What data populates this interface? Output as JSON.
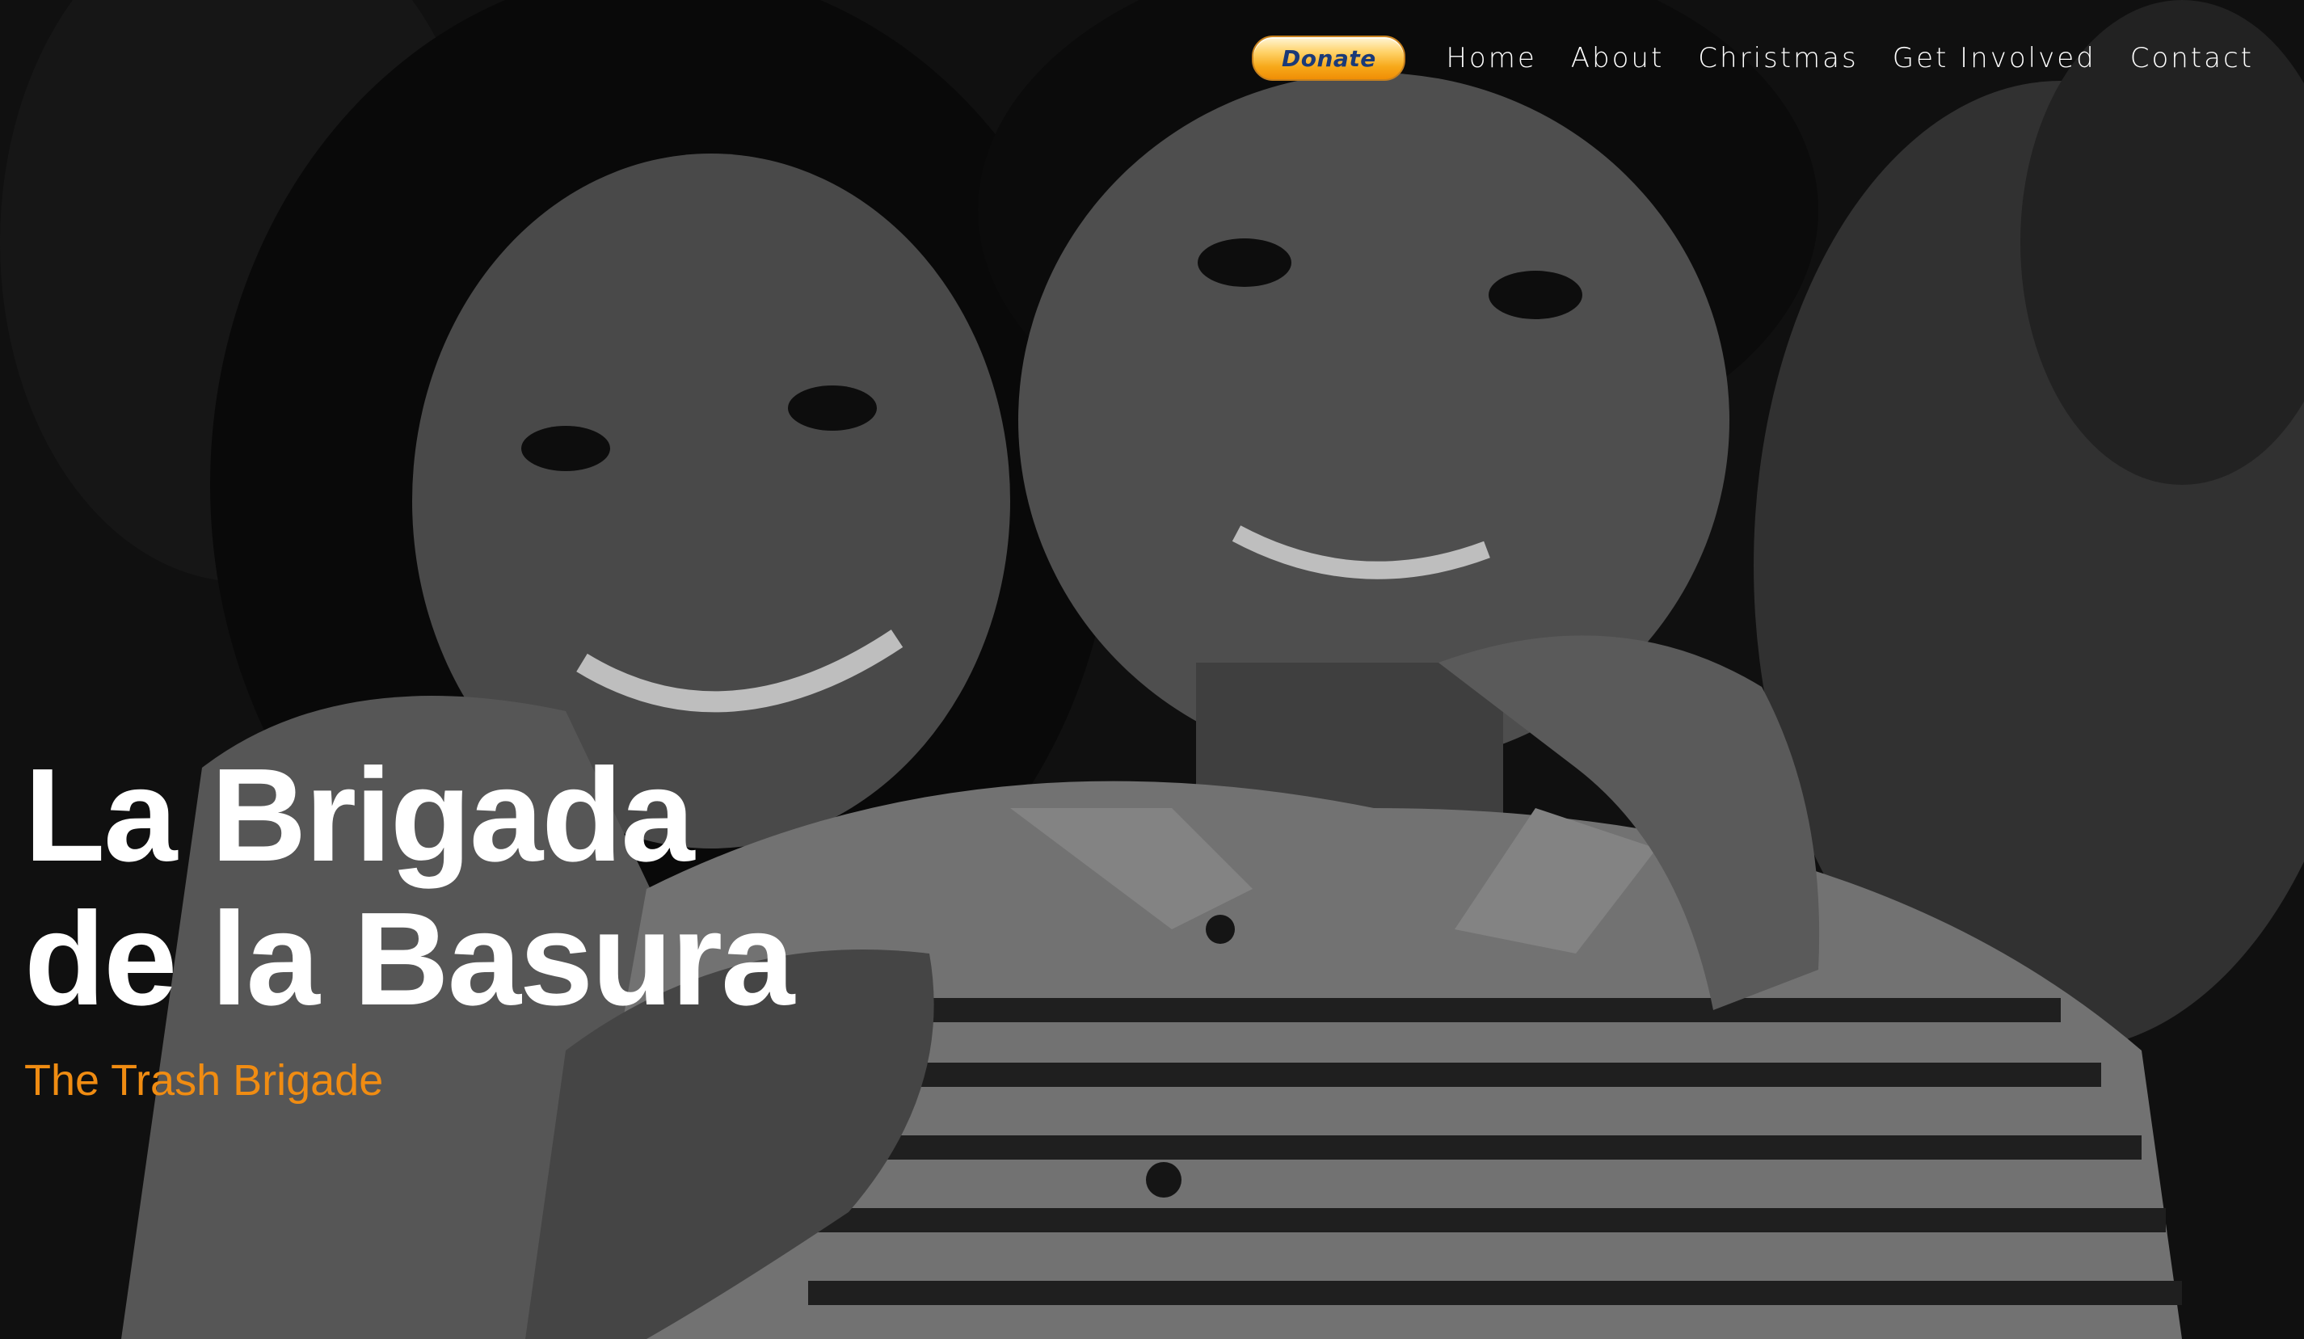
{
  "nav": {
    "donate_label": "Donate",
    "items": [
      {
        "label": "Home"
      },
      {
        "label": "About"
      },
      {
        "label": "Christmas"
      },
      {
        "label": "Get Involved"
      },
      {
        "label": "Contact"
      }
    ]
  },
  "hero": {
    "title_line1": "La Brigada",
    "title_line2": "de la Basura",
    "subtitle": "The Trash Brigade",
    "background": "grayscale photo of two smiling children, girl with arm around boy in striped polo shirt"
  },
  "colors": {
    "subtitle": "#f08c12",
    "title": "#ffffff",
    "nav_text": "#ffffff",
    "donate_text": "#1b3a78",
    "donate_fill": "#f7a91a"
  }
}
